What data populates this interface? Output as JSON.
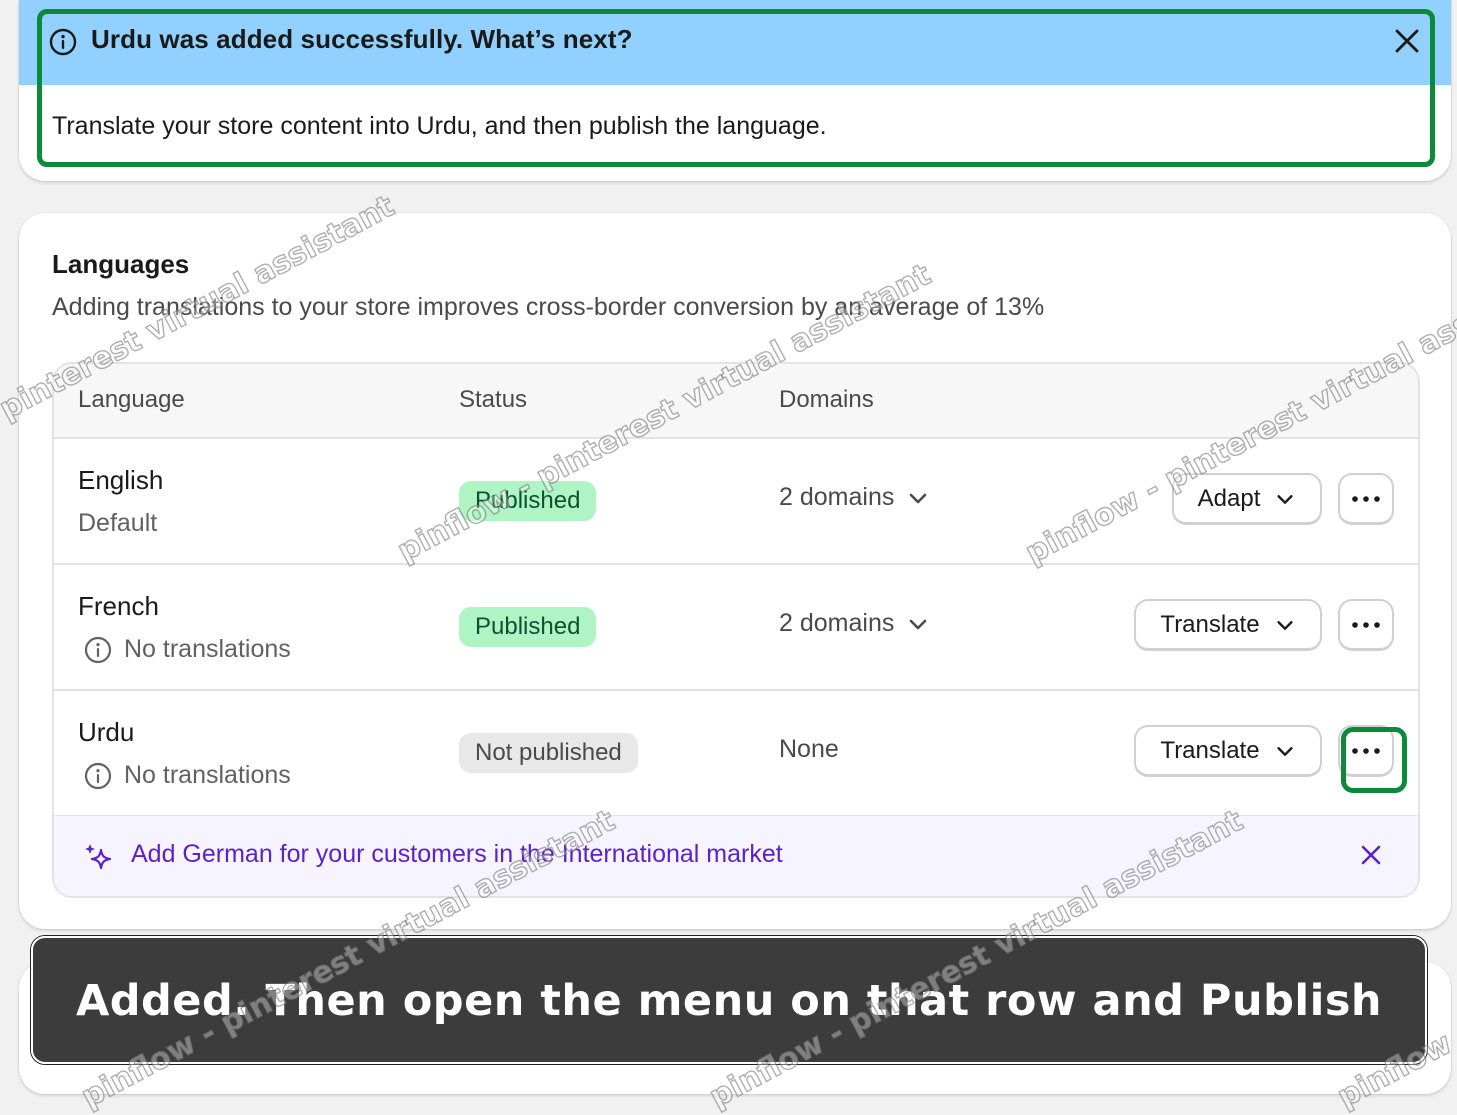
{
  "banner": {
    "title": "Urdu was added successfully. What’s next?",
    "body": "Translate your store content into Urdu, and then publish the language."
  },
  "languages": {
    "title": "Languages",
    "subtitle": "Adding translations to your store improves cross-border conversion by an average of 13%",
    "columns": {
      "language": "Language",
      "status": "Status",
      "domains": "Domains"
    },
    "rows": [
      {
        "name": "English",
        "meta": "Default",
        "status": "Published",
        "domains": "2 domains",
        "action": "Adapt"
      },
      {
        "name": "French",
        "meta": "No translations",
        "status": "Published",
        "domains": "2 domains",
        "action": "Translate"
      },
      {
        "name": "Urdu",
        "meta": "No translations",
        "status": "Not published",
        "domains": "None",
        "action": "Translate"
      }
    ],
    "promo": "Add German for your customers in the International market"
  },
  "caption": "Added. Then open the menu on that row and Publish",
  "watermark": {
    "a": "pinterest virtual assistant",
    "b": "pinflow - pinterest virtual assistant",
    "c": "pinflow"
  },
  "colors": {
    "banner_bg": "#91d0ff",
    "published_bg": "#aff5c3",
    "published_text": "#0c5132",
    "promo_text": "#5c21c9",
    "highlight": "#0a8a3a"
  },
  "icons": {
    "banner": "info-icon",
    "close": "close-icon",
    "dropdown": "chevron-down-icon",
    "more": "more-horizontal-icon",
    "sparkle": "sparkle-icon"
  }
}
